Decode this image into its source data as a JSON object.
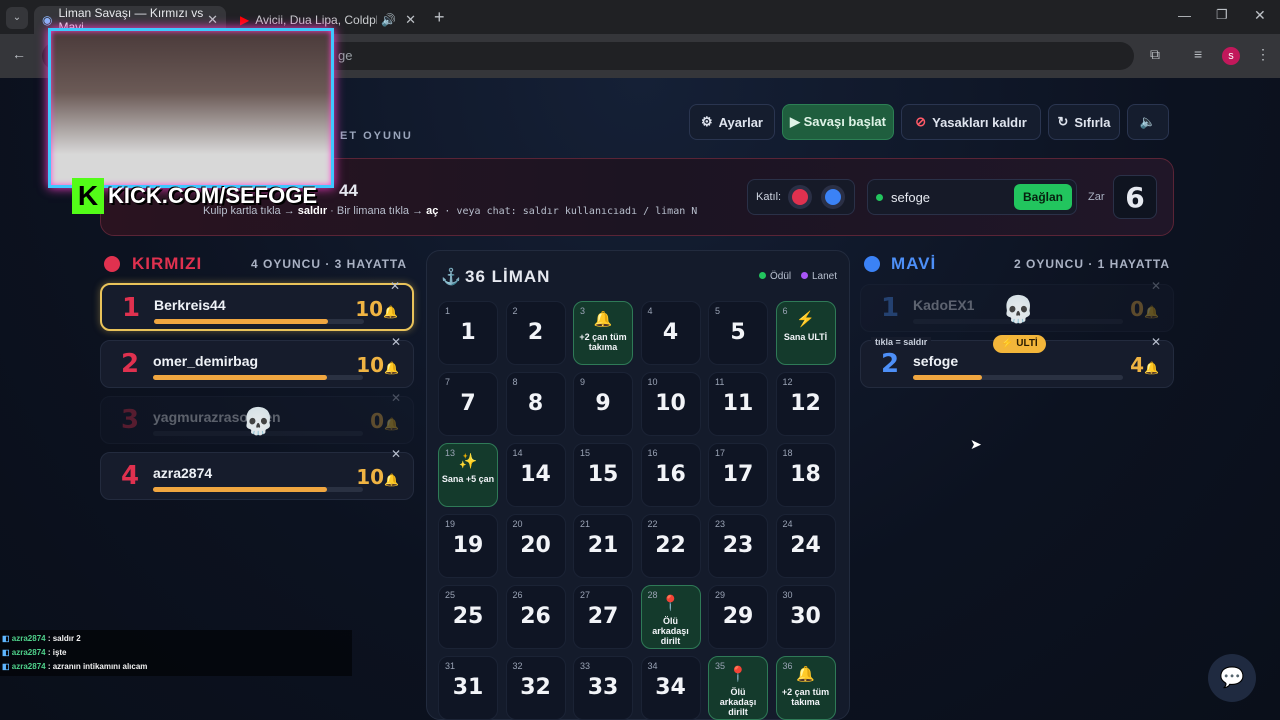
{
  "browser": {
    "tabs": [
      {
        "title": "Liman Savaşı — Kırmızı vs Mavi",
        "close": "✕"
      },
      {
        "title": "Avicii, Dua Lipa, Coldplay, M",
        "close": "✕"
      }
    ],
    "new_tab": "+",
    "url": "ge"
  },
  "header": {
    "settings": "Ayarlar",
    "start": "▶ Savaşı başlat",
    "unban": "Yasakları kaldır",
    "reset": "Sıfırla",
    "subtitle": "ET OYUNU"
  },
  "control": {
    "current_player": "44",
    "hint_a": "Kulip kartla tıkla → ",
    "hint_attack": "saldır",
    "hint_b": " · Bir limana tıkla → ",
    "hint_open": "aç",
    "hint_c": " · veya chat: saldır kullanıcıadı / liman N",
    "join_label": "Katıl:",
    "channel": "sefoge",
    "connect": "Bağlan",
    "dice_label": "Zar",
    "dice_value": "6"
  },
  "red": {
    "title": "KIRMIZI",
    "summary": "4 OYUNCU · 3 HAYATTA",
    "players": [
      {
        "num": "1",
        "name": "Berkreis44",
        "lives": "10",
        "bar": 0.83
      },
      {
        "num": "2",
        "name": "omer_demirbag",
        "lives": "10",
        "bar": 0.83
      },
      {
        "num": "3",
        "name": "yagmurazrasolmen",
        "lives": "0",
        "bar": 0
      },
      {
        "num": "4",
        "name": "azra2874",
        "lives": "10",
        "bar": 0.83
      }
    ]
  },
  "blue": {
    "title": "MAVİ",
    "summary": "2 OYUNCU · 1 HAYATTA",
    "players": [
      {
        "num": "1",
        "name": "KadoEX1",
        "lives": "0",
        "bar": 0
      },
      {
        "num": "2",
        "name": "sefoge",
        "lives": "4",
        "bar": 0.33,
        "tag": "tıkla = saldır",
        "badge": "ULTİ"
      }
    ]
  },
  "board": {
    "title": "36 LİMAN",
    "legend_reward": "Ödül",
    "legend_curse": "Lanet",
    "cells": [
      {
        "n": "1"
      },
      {
        "n": "2"
      },
      {
        "n": "3",
        "label": "+2 çan tüm takıma",
        "icon": "🔔"
      },
      {
        "n": "4"
      },
      {
        "n": "5"
      },
      {
        "n": "6",
        "label": "Sana ULTİ",
        "icon": "⚡"
      },
      {
        "n": "7"
      },
      {
        "n": "8"
      },
      {
        "n": "9"
      },
      {
        "n": "10"
      },
      {
        "n": "11"
      },
      {
        "n": "12"
      },
      {
        "n": "13",
        "label": "Sana +5 çan",
        "icon": "✨"
      },
      {
        "n": "14"
      },
      {
        "n": "15"
      },
      {
        "n": "16"
      },
      {
        "n": "17"
      },
      {
        "n": "18"
      },
      {
        "n": "19"
      },
      {
        "n": "20"
      },
      {
        "n": "21"
      },
      {
        "n": "22"
      },
      {
        "n": "23"
      },
      {
        "n": "24"
      },
      {
        "n": "25"
      },
      {
        "n": "26"
      },
      {
        "n": "27"
      },
      {
        "n": "28",
        "label": "Ölü arkadaşı dirilt",
        "icon": "📍"
      },
      {
        "n": "29"
      },
      {
        "n": "30"
      },
      {
        "n": "31"
      },
      {
        "n": "32"
      },
      {
        "n": "33"
      },
      {
        "n": "34"
      },
      {
        "n": "35",
        "label": "Ölü arkadaşı dirilt",
        "icon": "📍"
      },
      {
        "n": "36",
        "label": "+2 çan tüm takıma",
        "icon": "🔔"
      }
    ]
  },
  "overlay": {
    "kick": "KICK.COM/SEFOGE",
    "chat": [
      {
        "user": "azra2874",
        "msg": "saldır 2"
      },
      {
        "user": "azra2874",
        "msg": "işte"
      },
      {
        "user": "azra2874",
        "msg": "azranın intikamını alıcam"
      }
    ]
  },
  "colors": {
    "red": "#e0314f",
    "blue": "#3b82f6",
    "reward": "#22c55e",
    "curse": "#a855f7",
    "gold": "#f0a640"
  }
}
